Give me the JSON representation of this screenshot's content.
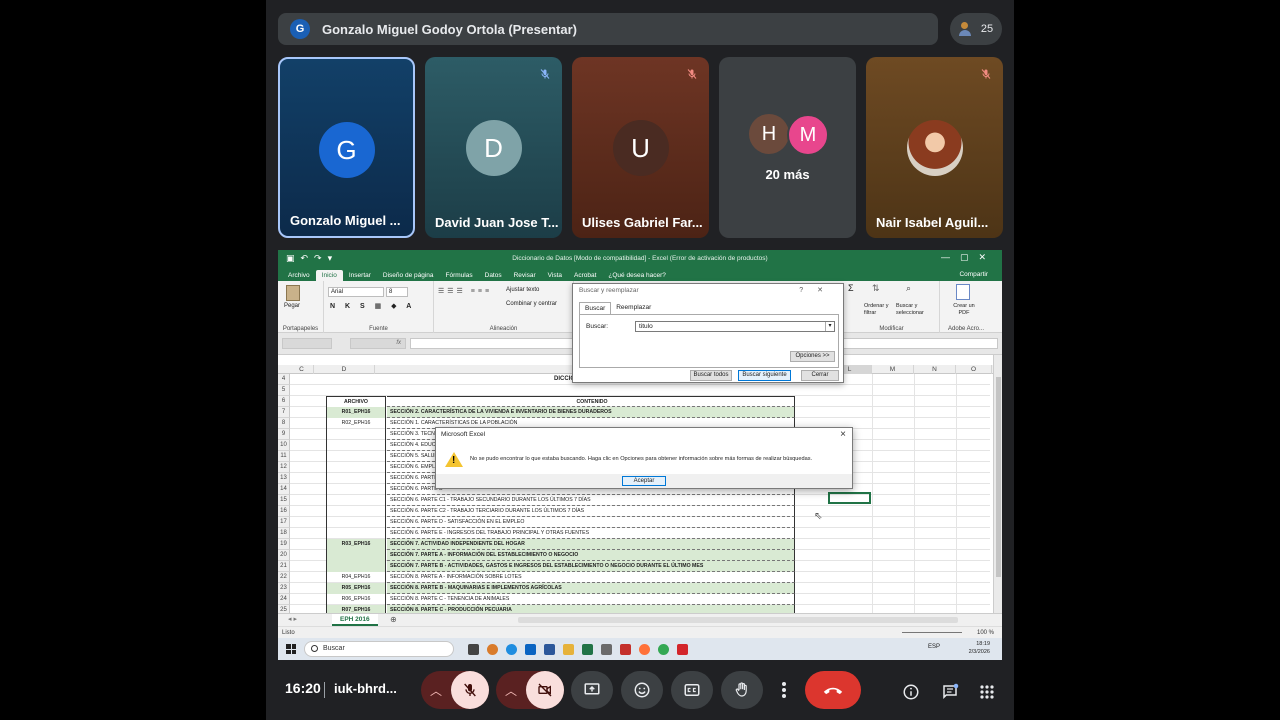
{
  "meet": {
    "presenter": {
      "initial": "G",
      "label": "Gonzalo Miguel Godoy Ortola (Presentar)"
    },
    "participant_count": "25",
    "tiles": [
      {
        "initial": "G",
        "name": "Gonzalo Miguel ..."
      },
      {
        "initial": "D",
        "name": "David Juan Jose T..."
      },
      {
        "initial": "U",
        "name": "Ulises Gabriel Far..."
      },
      {
        "initials": [
          "H",
          "M"
        ],
        "more": "20 más"
      },
      {
        "name": "Nair Isabel Aguil..."
      }
    ],
    "clock": "16:20",
    "meeting_code": "iuk-bhrd...",
    "colors": {
      "accent_border": "#a8c7fa",
      "hangup": "#dc362e",
      "excel_green": "#217346"
    }
  },
  "excel": {
    "title": "Diccionario de Datos [Modo de compatibilidad] - Excel (Error de activación de productos)",
    "tabs": [
      "Archivo",
      "Inicio",
      "Insertar",
      "Diseño de página",
      "Fórmulas",
      "Datos",
      "Revisar",
      "Vista",
      "Acrobat",
      "¿Qué desea hacer?"
    ],
    "share": "Compartir",
    "ribbon": {
      "paste": "Pegar",
      "clipboard": "Portapapeles",
      "font_name": "Arial",
      "font_size": "8",
      "font_group": "Fuente",
      "wrap": "Ajustar texto",
      "merge": "Combinar y centrar",
      "align_group": "Alineación",
      "sort": "Ordenar y filtrar",
      "find": "Buscar y seleccionar",
      "modify_group": "Modificar",
      "pdf": "Crear un PDF",
      "adobe_group": "Adobe Acro..."
    },
    "fx": "fx",
    "columns": [
      "C",
      "D",
      "E",
      "L",
      "M",
      "N",
      "O"
    ],
    "sheet_title": "DICCIONARIO DE VARI",
    "headers": {
      "archivo": "ARCHIVO",
      "contenido": "CONTENIDO"
    },
    "rows": [
      {
        "n": "4",
        "d": "",
        "e": "",
        "green": false
      },
      {
        "n": "5",
        "d": "",
        "e": "",
        "green": false
      },
      {
        "n": "6",
        "d": "ARCHIVO",
        "e": "CONTENIDO",
        "green": false,
        "header": true
      },
      {
        "n": "7",
        "d": "R01_EPH16",
        "e": "SECCIÓN 2. CARACTERÍSTICA DE LA VIVIENDA E INVENTARIO DE BIENES DURADEROS",
        "green": true
      },
      {
        "n": "8",
        "d": "R02_EPH16",
        "e": "SECCIÓN 1. CARACTERÍSTICAS DE LA POBLACIÓN",
        "green": false
      },
      {
        "n": "9",
        "d": "",
        "e": "SECCIÓN 3. TECNOLO",
        "green": false
      },
      {
        "n": "10",
        "d": "",
        "e": "SECCIÓN 4. EDUCACI",
        "green": false
      },
      {
        "n": "11",
        "d": "",
        "e": "SECCIÓN 5. SALUD DE",
        "green": false
      },
      {
        "n": "12",
        "d": "",
        "e": "SECCIÓN 6. EMPLEO E",
        "green": false
      },
      {
        "n": "13",
        "d": "",
        "e": "SECCIÓN 6. PARTE A -",
        "green": false
      },
      {
        "n": "14",
        "d": "",
        "e": "SECCIÓN 6. PARTE B -",
        "green": false
      },
      {
        "n": "15",
        "d": "",
        "e": "SECCIÓN 6. PARTE C1 - TRABAJO SECUNDARIO DURANTE  LOS ÚLTIMOS 7 DÍAS",
        "green": false
      },
      {
        "n": "16",
        "d": "",
        "e": "SECCIÓN 6. PARTE C2 - TRABAJO TERCIARIO DURANTE  LOS ÚLTIMOS 7 DÍAS",
        "green": false
      },
      {
        "n": "17",
        "d": "",
        "e": "SECCIÓN 6. PARTE D - SATISFACCIÓN EN EL EMPLEO",
        "green": false
      },
      {
        "n": "18",
        "d": "",
        "e": "SECCIÓN 6. PARTE E - INGRESOS DEL TRABAJO PRINCIPAL Y OTRAS FUENTES",
        "green": false
      },
      {
        "n": "19",
        "d": "R03_EPH16",
        "e": "SECCIÓN 7. ACTIVIDAD INDEPENDIENTE DEL HOGAR",
        "green": true
      },
      {
        "n": "20",
        "d": "",
        "e": "SECCIÓN 7. PARTE A - INFORMACIÓN DEL ESTABLECIMIENTO O NEGOCIO",
        "green": true
      },
      {
        "n": "21",
        "d": "",
        "e": "SECCIÓN 7. PARTE B - ACTIVIDADES, GASTOS E INGRESOS DEL ESTABLECIMIENTO O NEGOCIO DURANTE EL ÚLTIMO MES",
        "green": true
      },
      {
        "n": "22",
        "d": "R04_EPH16",
        "e": "SECCIÓN 8. PARTE A - INFORMACIÓN SOBRE LOTES",
        "green": false
      },
      {
        "n": "23",
        "d": "R05_EPH16",
        "e": "SECCIÓN 8. PARTE B - MAQUINARIAS E IMPLEMENTOS AGRÍCOLAS",
        "green": true
      },
      {
        "n": "24",
        "d": "R06_EPH16",
        "e": "SECCIÓN 8. PARTE C - TENENCIA DE ANIMALES",
        "green": false
      },
      {
        "n": "25",
        "d": "R07_EPH16",
        "e": "SECCIÓN 8. PARTE C - PRODUCCIÓN PECUARIA",
        "green": true
      }
    ],
    "sheet_tab": "EPH 2016",
    "status": "Listo",
    "zoom": "100 %",
    "find_dialog": {
      "title": "Buscar y reemplazar",
      "tab_find": "Buscar",
      "tab_replace": "Reemplazar",
      "find_label": "Buscar:",
      "find_value": "titulo",
      "options": "Opciones >>",
      "find_all": "Buscar todos",
      "find_next": "Buscar siguiente",
      "close": "Cerrar"
    },
    "message": {
      "title": "Microsoft Excel",
      "text": "No se pudo encontrar lo que estaba buscando. Haga clic en Opciones para obtener información sobre más formas de realizar búsquedas.",
      "ok": "Aceptar"
    },
    "taskbar": {
      "search": "Buscar",
      "lang": "ESP",
      "time": "18:19",
      "date": "2/3/2026"
    }
  }
}
